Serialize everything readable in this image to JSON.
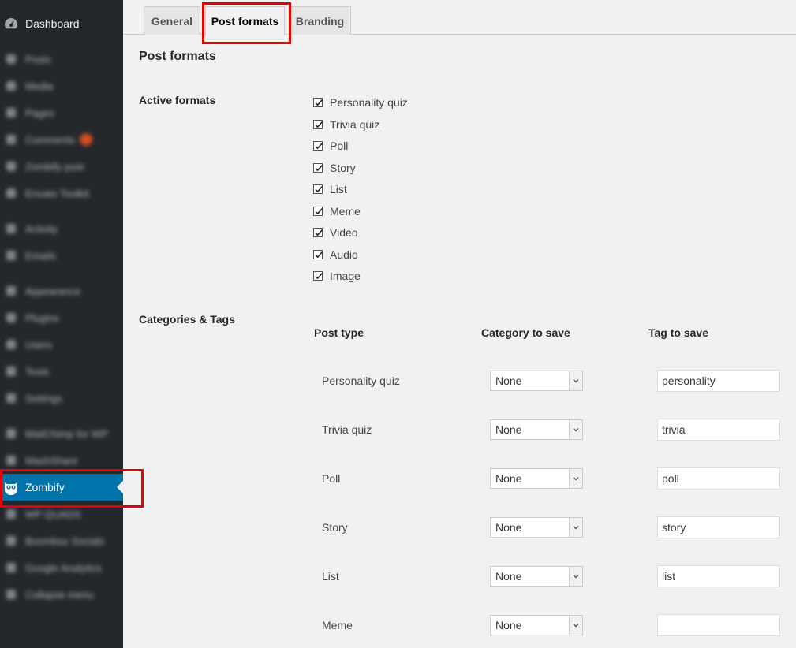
{
  "sidebar": {
    "dashboard": "Dashboard",
    "items": [
      {
        "label": "Posts",
        "icon": "pin-icon"
      },
      {
        "label": "Media",
        "icon": "media-icon"
      },
      {
        "label": "Pages",
        "icon": "page-icon"
      },
      {
        "label": "Comments",
        "icon": "comment-icon"
      },
      {
        "label": "Zombify post",
        "icon": "pin-icon"
      },
      {
        "label": "Envato Toolkit",
        "icon": "toolkit-icon"
      },
      {
        "label": "Activity",
        "icon": "activity-icon"
      },
      {
        "label": "Emails",
        "icon": "email-icon"
      },
      {
        "label": "Appearance",
        "icon": "brush-icon"
      },
      {
        "label": "Plugins",
        "icon": "plugin-icon"
      },
      {
        "label": "Users",
        "icon": "users-icon"
      },
      {
        "label": "Tools",
        "icon": "tools-icon"
      },
      {
        "label": "Settings",
        "icon": "settings-icon"
      },
      {
        "label": "MailChimp for WP",
        "icon": "mailchimp-icon"
      },
      {
        "label": "MashShare",
        "icon": "share-icon"
      },
      {
        "label": "WP QUADS",
        "icon": "quads-icon"
      },
      {
        "label": "Boombox Socials",
        "icon": "socials-icon"
      },
      {
        "label": "Google Analytics",
        "icon": "chart-icon"
      },
      {
        "label": "Collapse menu",
        "icon": "collapse-icon"
      }
    ],
    "current": "Zombify",
    "accent_color": "#0073aa",
    "highlight_color": "#e60000"
  },
  "tabs": [
    {
      "label": "General"
    },
    {
      "label": "Post formats"
    },
    {
      "label": "Branding"
    }
  ],
  "page": {
    "title": "Post formats",
    "active_formats_label": "Active formats",
    "categories_tags_label": "Categories & Tags"
  },
  "formats": [
    "Personality quiz",
    "Trivia quiz",
    "Poll",
    "Story",
    "List",
    "Meme",
    "Video",
    "Audio",
    "Image"
  ],
  "table": {
    "headers": {
      "post_type": "Post type",
      "category": "Category to save",
      "tag": "Tag to save"
    },
    "rows": [
      {
        "type": "Personality quiz",
        "category": "None",
        "tag": "personality"
      },
      {
        "type": "Trivia quiz",
        "category": "None",
        "tag": "trivia"
      },
      {
        "type": "Poll",
        "category": "None",
        "tag": "poll"
      },
      {
        "type": "Story",
        "category": "None",
        "tag": "story"
      },
      {
        "type": "List",
        "category": "None",
        "tag": "list"
      },
      {
        "type": "Meme",
        "category": "None",
        "tag": ""
      }
    ]
  }
}
